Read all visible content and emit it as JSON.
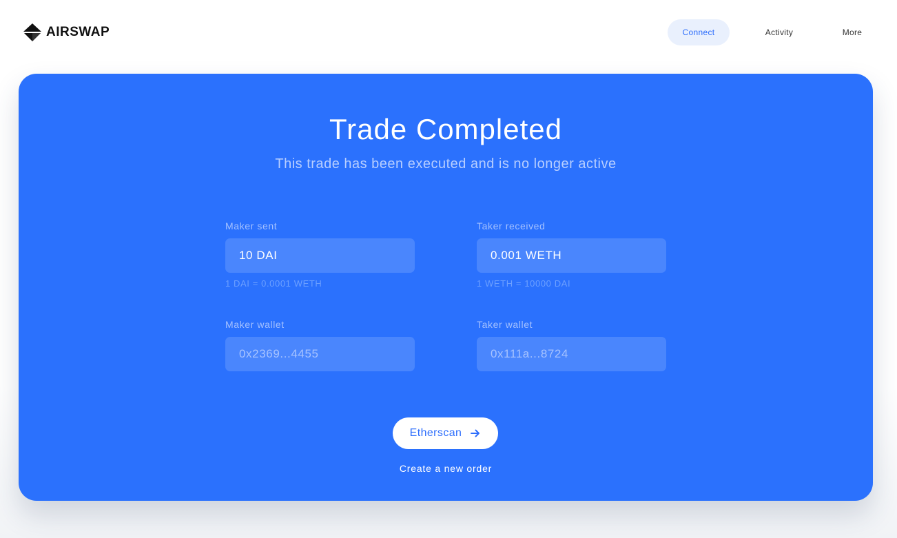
{
  "header": {
    "logo_text": "AIRSWAP",
    "nav": {
      "connect": "Connect",
      "activity": "Activity",
      "more": "More"
    }
  },
  "trade": {
    "title": "Trade Completed",
    "subtitle": "This trade has been executed and is no longer active",
    "maker_sent": {
      "label": "Maker sent",
      "value": "10 DAI",
      "rate": "1 DAI = 0.0001 WETH"
    },
    "taker_received": {
      "label": "Taker received",
      "value": "0.001 WETH",
      "rate": "1 WETH = 10000 DAI"
    },
    "maker_wallet": {
      "label": "Maker wallet",
      "value": "0x2369...4455"
    },
    "taker_wallet": {
      "label": "Taker wallet",
      "value": "0x111a...8724"
    },
    "etherscan_label": "Etherscan",
    "new_order_label": "Create a new order"
  },
  "colors": {
    "card_background": "#2b71fd",
    "field_background": "#4a86fd",
    "accent": "#2c6dfc"
  }
}
